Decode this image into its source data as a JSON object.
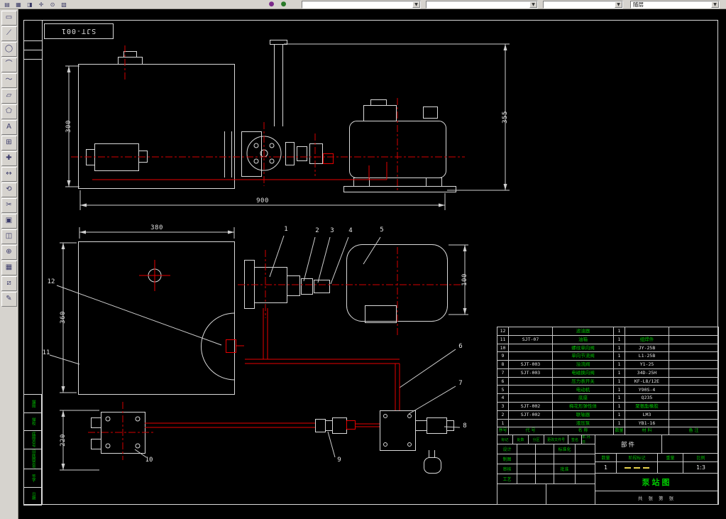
{
  "colors": {
    "canvas": "#000000",
    "chrome": "#d6d3ce",
    "linework": "#d9d9d9",
    "centerline_red": "#e60000",
    "annotation_green": "#00bf00",
    "stage_mark_yellow": "#e8d44d"
  },
  "top_toolbar": {
    "combos": [
      {
        "value": ""
      },
      {
        "value": ""
      },
      {
        "value": ""
      },
      {
        "value": "随层"
      }
    ]
  },
  "sheet": {
    "code": "SJT-001"
  },
  "dims": {
    "front_width": "900",
    "front_height": "355",
    "tank_height": "300",
    "plan_width": "380",
    "plan_depth": "360",
    "manifold_depth": "220",
    "motor_od": "100"
  },
  "callouts": [
    "1",
    "2",
    "3",
    "4",
    "5",
    "6",
    "7",
    "8",
    "9",
    "10",
    "11",
    "12"
  ],
  "bom": {
    "headers": [
      "序号",
      "代 号",
      "名 称",
      "数量",
      "材 料",
      "备 注"
    ],
    "rows": [
      {
        "no": "12",
        "code": "",
        "name": "滤油器",
        "qty": "1",
        "spec": "",
        "remark": ""
      },
      {
        "no": "11",
        "code": "SJT-07",
        "name": "油箱",
        "qty": "1",
        "spec": "组焊件",
        "remark": ""
      },
      {
        "no": "10",
        "code": "",
        "name": "螺纹单向阀",
        "qty": "1",
        "spec": "JY-25B",
        "remark": ""
      },
      {
        "no": "9",
        "code": "",
        "name": "单向节流阀",
        "qty": "1",
        "spec": "L1-25B",
        "remark": ""
      },
      {
        "no": "8",
        "code": "SJT-003",
        "name": "溢流阀",
        "qty": "1",
        "spec": "Y1-25",
        "remark": ""
      },
      {
        "no": "7",
        "code": "SJT-003",
        "name": "电磁换向阀",
        "qty": "1",
        "spec": "34D-25H",
        "remark": ""
      },
      {
        "no": "6",
        "code": "",
        "name": "压力表开关",
        "qty": "1",
        "spec": "KF-L8/12E",
        "remark": ""
      },
      {
        "no": "5",
        "code": "",
        "name": "电动机",
        "qty": "1",
        "spec": "Y90S-4",
        "remark": ""
      },
      {
        "no": "4",
        "code": "",
        "name": "底座",
        "qty": "1",
        "spec": "Q235",
        "remark": ""
      },
      {
        "no": "3",
        "code": "SJT-002",
        "name": "梅花形弹性体",
        "qty": "1",
        "spec": "聚氨酯橡胶",
        "remark": ""
      },
      {
        "no": "2",
        "code": "SJT-002",
        "name": "联轴器",
        "qty": "1",
        "spec": "LM3",
        "remark": ""
      },
      {
        "no": "1",
        "code": "",
        "name": "液压泵",
        "qty": "1",
        "spec": "YB1-16",
        "remark": ""
      }
    ]
  },
  "title_block": {
    "revision_headers": [
      "标记",
      "处数",
      "分区",
      "更改文件号",
      "签名",
      "年.月.日"
    ],
    "rows": [
      {
        "label": "设计",
        "label2": "标准化"
      },
      {
        "label": "制图",
        "label2": ""
      },
      {
        "label": "审核",
        "label2": "批准"
      },
      {
        "label": "工艺",
        "label2": ""
      }
    ],
    "part_type": "部件",
    "qty_label": "数量",
    "qty_value": "1",
    "stage_label": "阶段标记",
    "weight_label": "重量",
    "scale_label": "比例",
    "scale_value": "1:3",
    "drawing_title": "泵站图",
    "sheet_note": "共 张  第 张"
  },
  "margin_boxes": [
    "描图",
    "描校",
    "底图总号",
    "旧底图总号",
    "签字",
    "日期"
  ]
}
